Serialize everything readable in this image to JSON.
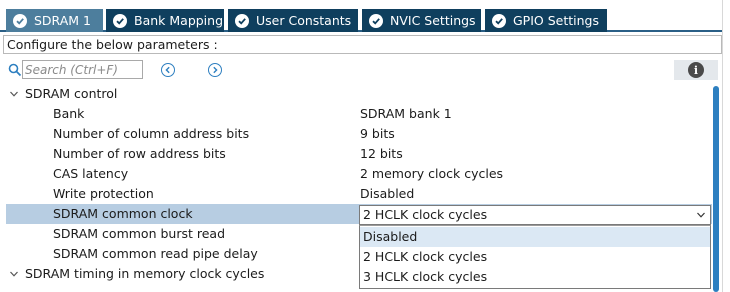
{
  "tabs": [
    {
      "label": "SDRAM 1",
      "active": true
    },
    {
      "label": "Bank Mapping",
      "active": false
    },
    {
      "label": "User Constants",
      "active": false
    },
    {
      "label": "NVIC Settings",
      "active": false
    },
    {
      "label": "GPIO Settings",
      "active": false
    }
  ],
  "config_text": "Configure the below parameters :",
  "search": {
    "placeholder": "Search (Ctrl+F)"
  },
  "icons": {
    "tab_icon": "check-circle-icon",
    "search": "search-icon",
    "prev": "circle-chevron-left-icon",
    "next": "circle-chevron-right-icon",
    "info": "info-icon"
  },
  "colors": {
    "tab_bg": "#0f3f5e",
    "tab_active_bg": "#4d7e9d",
    "selection": "#b7cde2",
    "accent": "#2d7fc0"
  },
  "groups": {
    "sdram_control": "SDRAM control",
    "timing": "SDRAM timing in memory clock cycles"
  },
  "params": [
    {
      "name": "Bank",
      "value": "SDRAM bank 1"
    },
    {
      "name": "Number of column address bits",
      "value": "9 bits"
    },
    {
      "name": "Number of row address bits",
      "value": "12 bits"
    },
    {
      "name": "CAS latency",
      "value": "2 memory clock cycles"
    },
    {
      "name": "Write protection",
      "value": "Disabled"
    },
    {
      "name": "SDRAM common clock",
      "value": "2 HCLK clock cycles"
    },
    {
      "name": "SDRAM common burst read",
      "value": ""
    },
    {
      "name": "SDRAM common read pipe delay",
      "value": ""
    }
  ],
  "dropdown": {
    "selected": "2 HCLK clock cycles",
    "options": [
      "Disabled",
      "2 HCLK clock cycles",
      "3 HCLK clock cycles"
    ],
    "highlighted_index": 0
  }
}
